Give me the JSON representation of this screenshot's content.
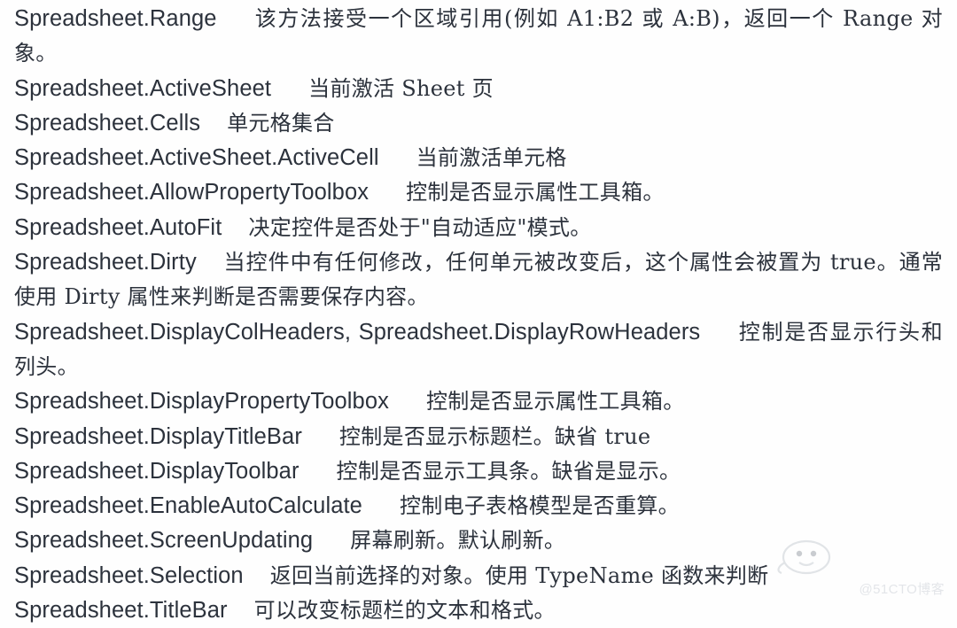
{
  "document": {
    "kind": "api-reference-text",
    "text_color": "#2c323c",
    "background_color": "#fefefe",
    "entries": [
      {
        "id": "range",
        "api": "Spreadsheet.Range",
        "gap": "wide",
        "desc": "该方法接受一个区域引用(例如 A1:B2 或 A:B)，返回一个 Range 对象。",
        "wraps": true
      },
      {
        "id": "activesheet",
        "api": "Spreadsheet.ActiveSheet",
        "gap": "wide",
        "desc": "当前激活 Sheet 页",
        "wraps": false
      },
      {
        "id": "cells",
        "api": "Spreadsheet.Cells",
        "gap": "medium",
        "desc": "单元格集合",
        "wraps": false
      },
      {
        "id": "activecell",
        "api": "Spreadsheet.ActiveSheet.ActiveCell",
        "gap": "wide",
        "desc": "当前激活单元格",
        "wraps": false
      },
      {
        "id": "allowpropertytoolbox",
        "api": "Spreadsheet.AllowPropertyToolbox",
        "gap": "wide",
        "desc": "控制是否显示属性工具箱。",
        "wraps": false
      },
      {
        "id": "autofit",
        "api": "Spreadsheet.AutoFit",
        "gap": "medium",
        "desc": "决定控件是否处于\"自动适应\"模式。",
        "wraps": false
      },
      {
        "id": "dirty",
        "api": "Spreadsheet.Dirty",
        "gap": "medium",
        "desc": "当控件中有任何修改，任何单元被改变后，这个属性会被置为 true。通常使用 Dirty 属性来判断是否需要保存内容。",
        "wraps": true
      },
      {
        "id": "displaycolrowheaders",
        "api": "Spreadsheet.DisplayColHeaders,  Spreadsheet.DisplayRowHeaders",
        "gap": "wide",
        "desc": "控制是否显示行头和列头。",
        "wraps": true
      },
      {
        "id": "displaypropertytoolbox",
        "api": "Spreadsheet.DisplayPropertyToolbox",
        "gap": "wide",
        "desc": "控制是否显示属性工具箱。",
        "wraps": false
      },
      {
        "id": "displaytitlebar",
        "api": "Spreadsheet.DisplayTitleBar",
        "gap": "wide",
        "desc": "控制是否显示标题栏。缺省 true",
        "wraps": false
      },
      {
        "id": "displaytoolbar",
        "api": "Spreadsheet.DisplayToolbar",
        "gap": "wide",
        "desc": "控制是否显示工具条。缺省是显示。",
        "wraps": false
      },
      {
        "id": "enableautocalculate",
        "api": "Spreadsheet.EnableAutoCalculate",
        "gap": "wide",
        "desc": "控制电子表格模型是否重算。",
        "wraps": false
      },
      {
        "id": "screenupdating",
        "api": "Spreadsheet.ScreenUpdating",
        "gap": "wide",
        "desc": "屏幕刷新。默认刷新。",
        "wraps": false
      },
      {
        "id": "selection",
        "api": "Spreadsheet.Selection",
        "gap": "medium",
        "desc": "返回当前选择的对象。使用 TypeName 函数来判断",
        "wraps": false
      },
      {
        "id": "titlebar",
        "api": "Spreadsheet.TitleBar",
        "gap": "medium",
        "desc": "可以改变标题栏的文本和格式。",
        "wraps": false
      }
    ]
  },
  "watermark": {
    "text": "@51CTO博客",
    "color": "#cdd2d8"
  }
}
